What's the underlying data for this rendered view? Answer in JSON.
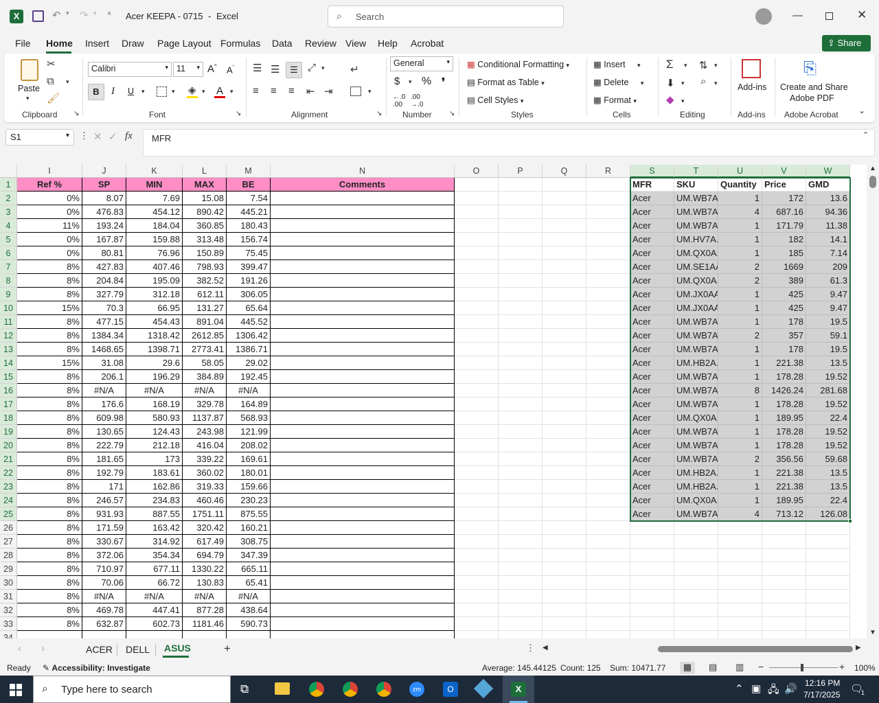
{
  "title": {
    "doc_name": "Acer KEEPA - 0715",
    "app_name": "Excel",
    "separator": "-",
    "search_placeholder": "Search"
  },
  "menu": [
    "File",
    "Home",
    "Insert",
    "Draw",
    "Page Layout",
    "Formulas",
    "Data",
    "Review",
    "View",
    "Help",
    "Acrobat"
  ],
  "share_label": "Share",
  "ribbon": {
    "paste": "Paste",
    "clipboard": "Clipboard",
    "font_name": "Calibri",
    "font_size": "11",
    "font_group": "Font",
    "alignment_group": "Alignment",
    "number_format": "General",
    "number_group": "Number",
    "cond_format": "Conditional Formatting",
    "format_table": "Format as Table",
    "cell_styles": "Cell Styles",
    "styles_group": "Styles",
    "insert": "Insert",
    "delete": "Delete",
    "format": "Format",
    "cells_group": "Cells",
    "editing_group": "Editing",
    "addins": "Add-ins",
    "addins_group": "Add-ins",
    "create_pdf_1": "Create and Share",
    "create_pdf_2": "Adobe PDF",
    "adobe_group": "Adobe Acrobat",
    "bold": "B",
    "italic": "I",
    "underline": "U"
  },
  "formula_bar": {
    "cell_ref": "S1",
    "content": "MFR",
    "fx": "fx"
  },
  "columns": [
    "I",
    "J",
    "K",
    "L",
    "M",
    "N",
    "O",
    "P",
    "Q",
    "R",
    "S",
    "T",
    "U",
    "V",
    "W"
  ],
  "left_headers": [
    "Ref %",
    "SP",
    "MIN",
    "MAX",
    "BE",
    "Comments"
  ],
  "left_rows": [
    [
      "0%",
      "8.07",
      "7.69",
      "15.08",
      "7.54"
    ],
    [
      "0%",
      "476.83",
      "454.12",
      "890.42",
      "445.21"
    ],
    [
      "11%",
      "193.24",
      "184.04",
      "360.85",
      "180.43"
    ],
    [
      "0%",
      "167.87",
      "159.88",
      "313.48",
      "156.74"
    ],
    [
      "0%",
      "80.81",
      "76.96",
      "150.89",
      "75.45"
    ],
    [
      "8%",
      "427.83",
      "407.46",
      "798.93",
      "399.47"
    ],
    [
      "8%",
      "204.84",
      "195.09",
      "382.52",
      "191.26"
    ],
    [
      "8%",
      "327.79",
      "312.18",
      "612.11",
      "306.05"
    ],
    [
      "15%",
      "70.3",
      "66.95",
      "131.27",
      "65.64"
    ],
    [
      "8%",
      "477.15",
      "454.43",
      "891.04",
      "445.52"
    ],
    [
      "8%",
      "1384.34",
      "1318.42",
      "2612.85",
      "1306.42"
    ],
    [
      "8%",
      "1468.65",
      "1398.71",
      "2773.41",
      "1386.71"
    ],
    [
      "15%",
      "31.08",
      "29.6",
      "58.05",
      "29.02"
    ],
    [
      "8%",
      "206.1",
      "196.29",
      "384.89",
      "192.45"
    ],
    [
      "8%",
      "#N/A",
      "#N/A",
      "#N/A",
      "#N/A"
    ],
    [
      "8%",
      "176.6",
      "168.19",
      "329.78",
      "164.89"
    ],
    [
      "8%",
      "609.98",
      "580.93",
      "1137.87",
      "568.93"
    ],
    [
      "8%",
      "130.65",
      "124.43",
      "243.98",
      "121.99"
    ],
    [
      "8%",
      "222.79",
      "212.18",
      "416.04",
      "208.02"
    ],
    [
      "8%",
      "181.65",
      "173",
      "339.22",
      "169.61"
    ],
    [
      "8%",
      "192.79",
      "183.61",
      "360.02",
      "180.01"
    ],
    [
      "8%",
      "171",
      "162.86",
      "319.33",
      "159.66"
    ],
    [
      "8%",
      "246.57",
      "234.83",
      "460.46",
      "230.23"
    ],
    [
      "8%",
      "931.93",
      "887.55",
      "1751.11",
      "875.55"
    ],
    [
      "8%",
      "171.59",
      "163.42",
      "320.42",
      "160.21"
    ],
    [
      "8%",
      "330.67",
      "314.92",
      "617.49",
      "308.75"
    ],
    [
      "8%",
      "372.06",
      "354.34",
      "694.79",
      "347.39"
    ],
    [
      "8%",
      "710.97",
      "677.11",
      "1330.22",
      "665.11"
    ],
    [
      "8%",
      "70.06",
      "66.72",
      "130.83",
      "65.41"
    ],
    [
      "8%",
      "#N/A",
      "#N/A",
      "#N/A",
      "#N/A"
    ],
    [
      "8%",
      "469.78",
      "447.41",
      "877.28",
      "438.64"
    ],
    [
      "8%",
      "632.87",
      "602.73",
      "1181.46",
      "590.73"
    ]
  ],
  "right_headers": [
    "MFR",
    "SKU",
    "Quantity",
    "Price",
    "GMD"
  ],
  "right_rows": [
    [
      "Acer",
      "UM.WB7A",
      "1",
      "172",
      "13.6"
    ],
    [
      "Acer",
      "UM.WB7A",
      "4",
      "687.16",
      "94.36"
    ],
    [
      "Acer",
      "UM.WB7A",
      "1",
      "171.79",
      "11.38"
    ],
    [
      "Acer",
      "UM.HV7A.",
      "1",
      "182",
      "14.1"
    ],
    [
      "Acer",
      "UM.QX0A.",
      "1",
      "185",
      "7.14"
    ],
    [
      "Acer",
      "UM.SE1AA",
      "2",
      "1669",
      "209"
    ],
    [
      "Acer",
      "UM.QX0A.",
      "2",
      "389",
      "61.3"
    ],
    [
      "Acer",
      "UM.JX0AA",
      "1",
      "425",
      "9.47"
    ],
    [
      "Acer",
      "UM.JX0AA",
      "1",
      "425",
      "9.47"
    ],
    [
      "Acer",
      "UM.WB7A",
      "1",
      "178",
      "19.5"
    ],
    [
      "Acer",
      "UM.WB7A",
      "2",
      "357",
      "59.1"
    ],
    [
      "Acer",
      "UM.WB7A",
      "1",
      "178",
      "19.5"
    ],
    [
      "Acer",
      "UM.HB2A.",
      "1",
      "221.38",
      "13.5"
    ],
    [
      "Acer",
      "UM.WB7A",
      "1",
      "178.28",
      "19.52"
    ],
    [
      "Acer",
      "UM.WB7A",
      "8",
      "1426.24",
      "281.68"
    ],
    [
      "Acer",
      "UM.WB7A",
      "1",
      "178.28",
      "19.52"
    ],
    [
      "Acer",
      "UM.QX0A.",
      "1",
      "189.95",
      "22.4"
    ],
    [
      "Acer",
      "UM.WB7A",
      "1",
      "178.28",
      "19.52"
    ],
    [
      "Acer",
      "UM.WB7A",
      "1",
      "178.28",
      "19.52"
    ],
    [
      "Acer",
      "UM.WB7A",
      "2",
      "356.56",
      "59.68"
    ],
    [
      "Acer",
      "UM.HB2A.",
      "1",
      "221.38",
      "13.5"
    ],
    [
      "Acer",
      "UM.HB2A.",
      "1",
      "221.38",
      "13.5"
    ],
    [
      "Acer",
      "UM.QX0A.",
      "1",
      "189.95",
      "22.4"
    ],
    [
      "Acer",
      "UM.WB7A",
      "4",
      "713.12",
      "126.08"
    ]
  ],
  "sheet_tabs": [
    "ACER",
    "DELL",
    "ASUS"
  ],
  "active_tab": "ASUS",
  "status": {
    "ready": "Ready",
    "accessibility": "Accessibility: Investigate",
    "average": "Average: 145.44125",
    "count": "Count: 125",
    "sum": "Sum: 10471.77",
    "zoom": "100%"
  },
  "taskbar": {
    "search_placeholder": "Type here to search",
    "time": "12:16 PM",
    "date": "7/17/2025",
    "notif_count": "1"
  },
  "colors": {
    "excel_green": "#1e6e3a",
    "pink_header": "#ff8ec6",
    "selection_gray": "#d2d2d2"
  }
}
